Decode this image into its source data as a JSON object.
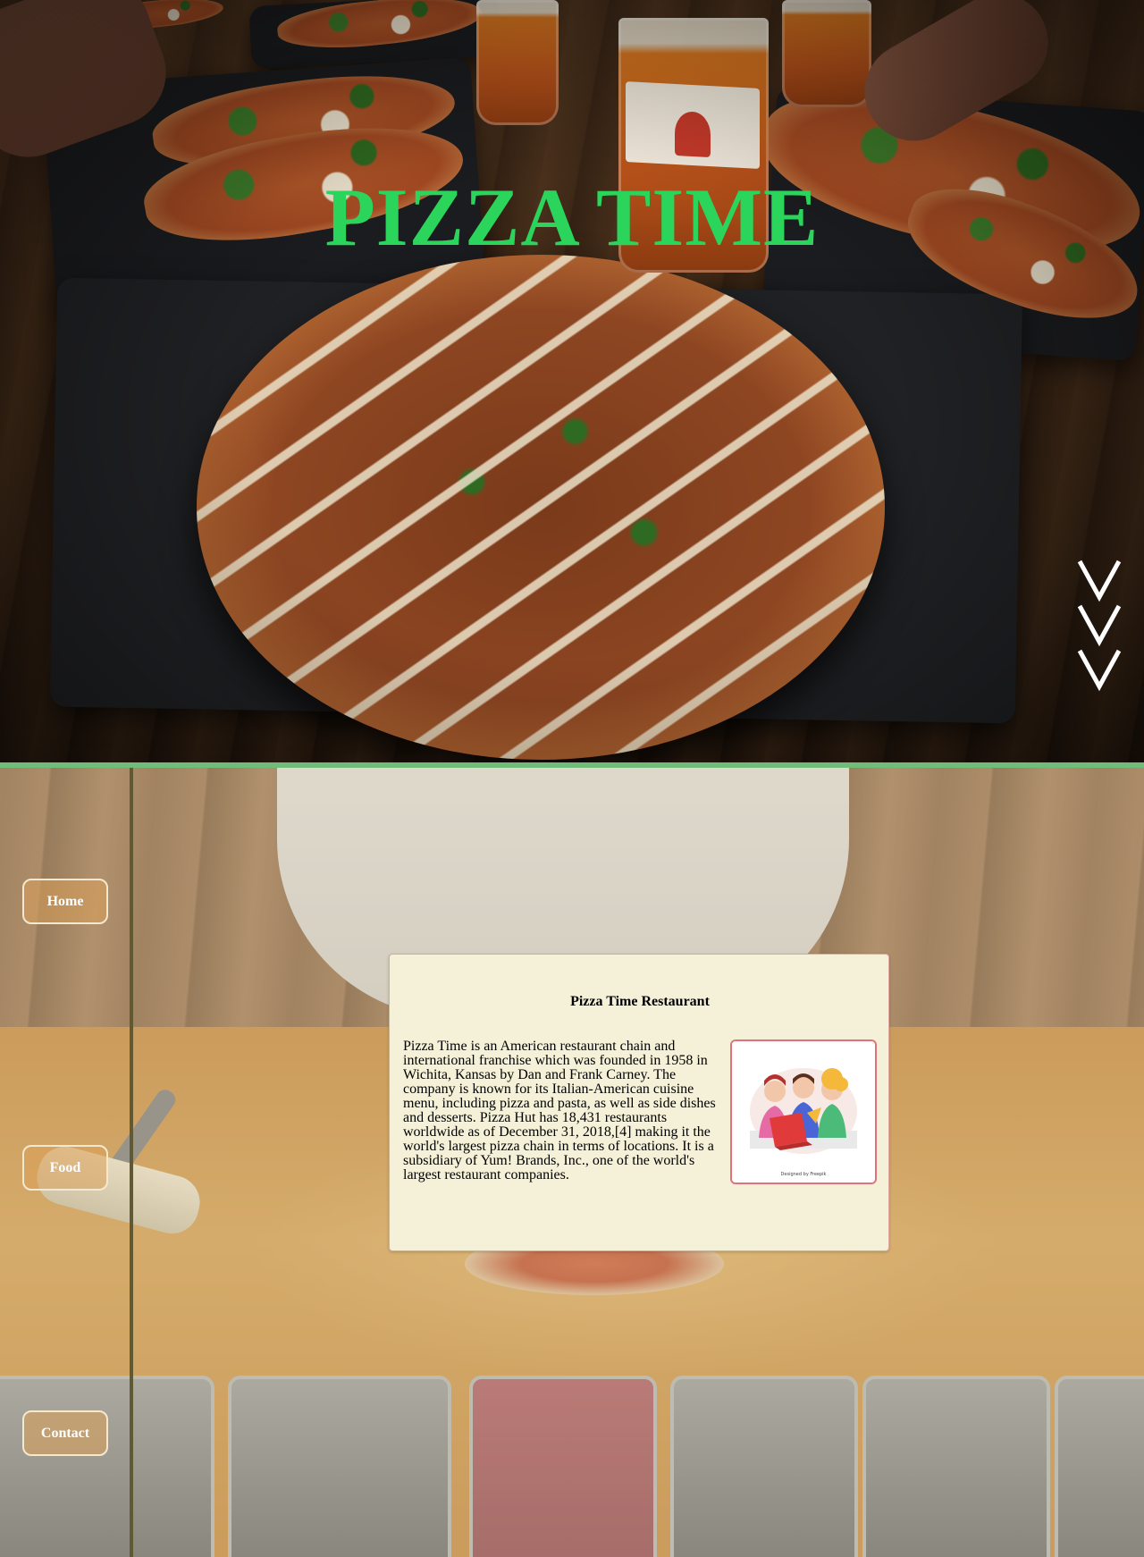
{
  "hero": {
    "title": "PIZZA TIME",
    "title_color": "#2bd45b",
    "scroll_indicator_icon": "triple-chevron-down-icon",
    "divider_color": "#6fbd79"
  },
  "nav": {
    "items": [
      {
        "label": "Home"
      },
      {
        "label": "Food"
      },
      {
        "label": "Contact"
      }
    ]
  },
  "card": {
    "title": "Pizza Time Restaurant",
    "body": "Pizza Time is an American restaurant chain and international franchise which was founded in 1958 in Wichita, Kansas by Dan and Frank Carney. The company is known for its Italian-American cuisine menu, including pizza and pasta, as well as side dishes and desserts. Pizza Hut has 18,431 restaurants worldwide as of December 31, 2018,[4] making it the world's largest pizza chain in terms of locations. It is a subsidiary of Yum! Brands, Inc., one of the world's largest restaurant companies.",
    "image_icon": "friends-eating-pizza-illustration",
    "image_caption": "Designed by Freepik"
  }
}
